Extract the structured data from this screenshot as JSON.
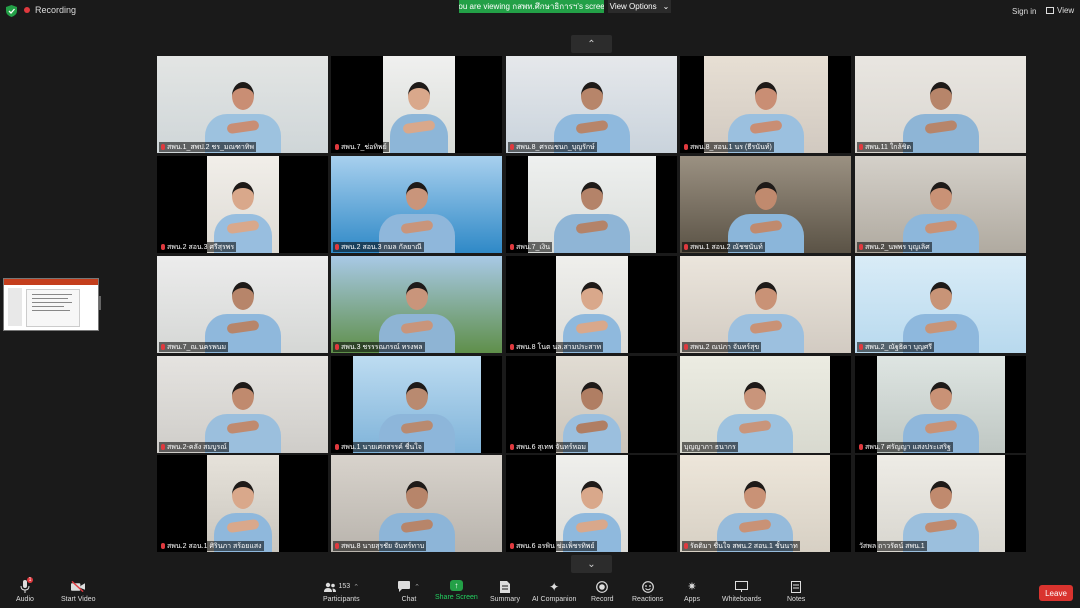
{
  "topbar": {
    "recording_label": "Recording",
    "viewing_text": "You are viewing กสพท.ศึกษาธิการฯ's screen",
    "view_options_label": "View Options",
    "sign_in_label": "Sign in",
    "view_label": "View"
  },
  "gallery": {
    "tiles": [
      {
        "name": "สพน.1_สพป.2 ชร_มณฑาทิพ",
        "muted": true
      },
      {
        "name": "สพน.7_ช่อทิพย์",
        "muted": true
      },
      {
        "name": "สพน.8_ศรณชนก_บุญรักษ์",
        "muted": true
      },
      {
        "name": "สพน.8_สอน.1 นร (ธีรนันท์)",
        "muted": true
      },
      {
        "name": "สพน.11 ใกล้ชิด",
        "muted": true
      },
      {
        "name": "สพน.2 สอน.3 ศรีสุรพร",
        "muted": true
      },
      {
        "name": "สพน.2 สอน.3 กมล กัลยาณี",
        "muted": true
      },
      {
        "name": "สพน.7_เงิน",
        "muted": true
      },
      {
        "name": "สพน.1 สอน.2 ณัชชนันท์",
        "muted": true
      },
      {
        "name": "สพน.2_นพพร บุญเลิศ",
        "muted": true
      },
      {
        "name": "สพน.7_ณ.นครพนม",
        "muted": true
      },
      {
        "name": "สพน.3 ชรรรณภรณ์ ทรงพล",
        "muted": true
      },
      {
        "name": "สพน.8 โนต นล.สามประสาท",
        "muted": true
      },
      {
        "name": "สพน.2 ณปภา จันทร์สุข",
        "muted": true
      },
      {
        "name": "สพน.2_ณัฐธิดา บุญศรี",
        "muted": true
      },
      {
        "name": "สพน.2-คลัง สมบูรณ์",
        "muted": true
      },
      {
        "name": "สพน.1 นายเศกสรรค์ ชื่นใจ",
        "muted": true
      },
      {
        "name": "สพน.6 สุเทพ จันทร์หอม",
        "muted": true
      },
      {
        "name": "บุญญาภา ธนากร",
        "muted": false
      },
      {
        "name": "สพน.7 ศรัญญา แสงประเสริฐ",
        "muted": true
      },
      {
        "name": "สพน.2 สอน.1 ศิรินภา สร้อยแสง",
        "muted": true
      },
      {
        "name": "สพน.8 นายสุรชัย จันทร์ทาบ",
        "muted": true
      },
      {
        "name": "สพน.6 อรพิน ช่อเพ็ชรทิพย์",
        "muted": true
      },
      {
        "name": "รัตติมา ชื่นใจ สพน.2 สอน.1 ชั้นนาท",
        "muted": true
      },
      {
        "name": "วัสพล ถาวรัตน์ สพน.1",
        "muted": false
      }
    ]
  },
  "toolbar": {
    "audio_label": "Audio",
    "audio_badge": "1",
    "video_label": "Start Video",
    "participants_count": "153",
    "participants_label": "Participants",
    "chat_label": "Chat",
    "share_label": "Share Screen",
    "summary_label": "Summary",
    "companion_label": "AI Companion",
    "record_label": "Record",
    "reactions_label": "Reactions",
    "apps_label": "Apps",
    "whiteboards_label": "Whiteboards",
    "notes_label": "Notes",
    "leave_label": "Leave"
  },
  "colors": {
    "accent_green": "#23a047",
    "leave_red": "#d9332e",
    "background": "#1a1a1a",
    "uniform_blue": "#8fb9db"
  },
  "icons": [
    "shield-icon",
    "record-dot-icon",
    "chevron-up-icon",
    "chevron-down-icon",
    "microphone-icon",
    "video-off-icon",
    "participants-icon",
    "chat-icon",
    "share-screen-icon",
    "summary-icon",
    "ai-companion-icon",
    "record-icon",
    "reactions-icon",
    "apps-icon",
    "whiteboards-icon",
    "notes-icon",
    "muted-mic-icon"
  ]
}
